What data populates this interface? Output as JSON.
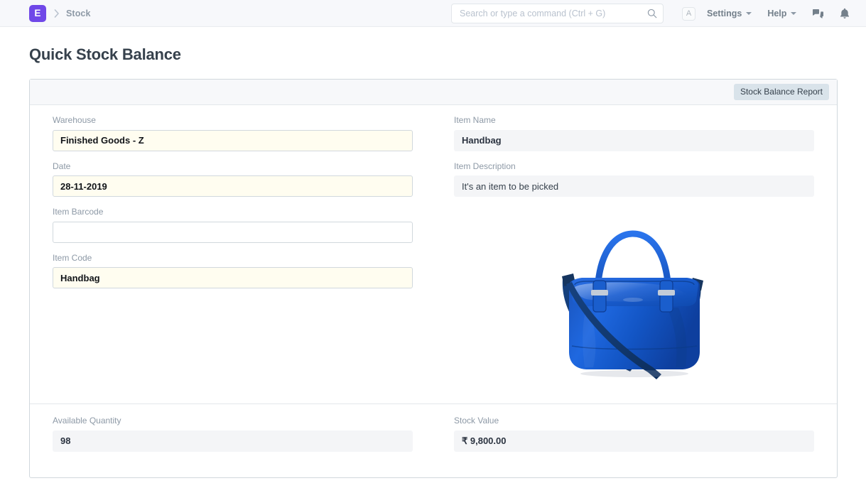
{
  "navbar": {
    "logo_letter": "E",
    "breadcrumb": "Stock",
    "breadcrumb_separator_icon": "chevron-right-icon",
    "search": {
      "placeholder": "Search or type a command (Ctrl + G)",
      "value": "",
      "icon": "search-icon"
    },
    "avatar_letter": "A",
    "settings_label": "Settings",
    "help_label": "Help",
    "chat_icon": "comments-icon",
    "notification_icon": "bell-icon",
    "accent_color": "#7048e8"
  },
  "page": {
    "title": "Quick Stock Balance"
  },
  "toolbar": {
    "report_button_label": "Stock Balance Report"
  },
  "form": {
    "left": [
      {
        "label": "Warehouse",
        "value": "Finished Goods - Z",
        "style": "mandatory",
        "name": "warehouse"
      },
      {
        "label": "Date",
        "value": "28-11-2019",
        "style": "mandatory",
        "name": "date"
      },
      {
        "label": "Item Barcode",
        "value": "",
        "style": "empty",
        "name": "item-barcode"
      },
      {
        "label": "Item Code",
        "value": "Handbag",
        "style": "mandatory",
        "name": "item-code"
      }
    ],
    "right": [
      {
        "label": "Item Name",
        "value": "Handbag",
        "style": "readonly-bold",
        "name": "item-name"
      },
      {
        "label": "Item Description",
        "value": "It's an item to be picked",
        "style": "readonly",
        "name": "item-description"
      }
    ],
    "item_image": {
      "alt": "blue-handbag-image",
      "colors": {
        "body_light": "#1f63d6",
        "body": "#1456c8",
        "body_dark": "#0d3fa0",
        "strap": "#0b3徐"
      }
    }
  },
  "summary": {
    "available_quantity": {
      "label": "Available Quantity",
      "value": "98"
    },
    "stock_value": {
      "label": "Stock Value",
      "value": "₹ 9,800.00"
    }
  }
}
